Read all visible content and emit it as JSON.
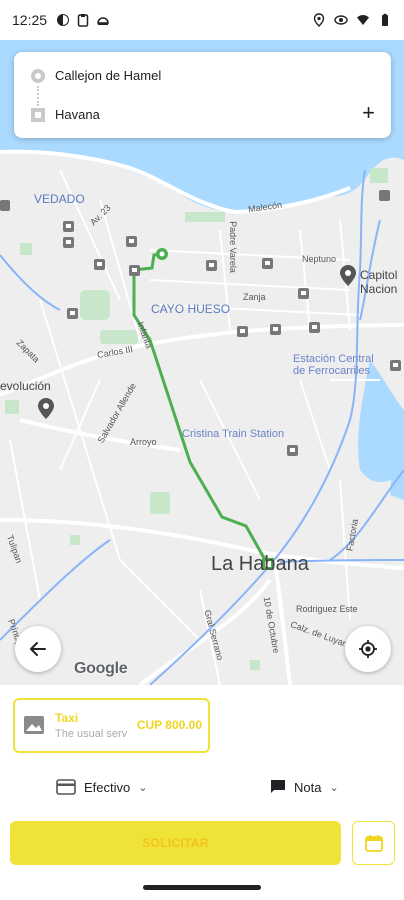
{
  "status_bar": {
    "time": "12:25",
    "left_icons": [
      "app-icon",
      "clipboard-icon",
      "android-icon"
    ],
    "right_icons": [
      "location-icon",
      "eye-icon",
      "wifi-icon",
      "battery-icon"
    ]
  },
  "route": {
    "origin": "Callejon de Hamel",
    "destination": "Havana",
    "add_stop_label": "+"
  },
  "map": {
    "labels": {
      "el_vedado": "VEDADO",
      "cayo_hueso": "CAYO HUESO",
      "la_habana": "La Habana",
      "capitolio": "Capitol\nNacion",
      "estacion": "Estación Central\nde Ferrocarriles",
      "cristina": "Cristina Train Station",
      "revolucion": "evolución",
      "malecon": "Malecón",
      "neptuno": "Neptuno",
      "zanja": "Zanja",
      "carlos": "Carlos III",
      "arroyo": "Arroyo",
      "rodriguez": "Rodriguez Este",
      "zapata": "Zapata",
      "tulipan": "Tulipan",
      "principe": "Príncipe",
      "infanta": "Infanta",
      "padre_varela": "Padre Varela",
      "salvador": "Salvador Allende",
      "factoria": "Factoria",
      "calle_23": "Av. 23",
      "calzada_luyano": "Calz. de Luyano",
      "avenida_oct": "10 de Octubre",
      "gral_serrano": "Gral Serrano"
    },
    "route_color": "#4caf50",
    "google_logo": "Google"
  },
  "service": {
    "name": "Taxi",
    "description": "The usual service",
    "price": "CUP 800.00",
    "accent_color": "#f0e338"
  },
  "payment": {
    "method": "Efectivo",
    "note_label": "Nota"
  },
  "actions": {
    "request_label": "SOLICITAR"
  }
}
